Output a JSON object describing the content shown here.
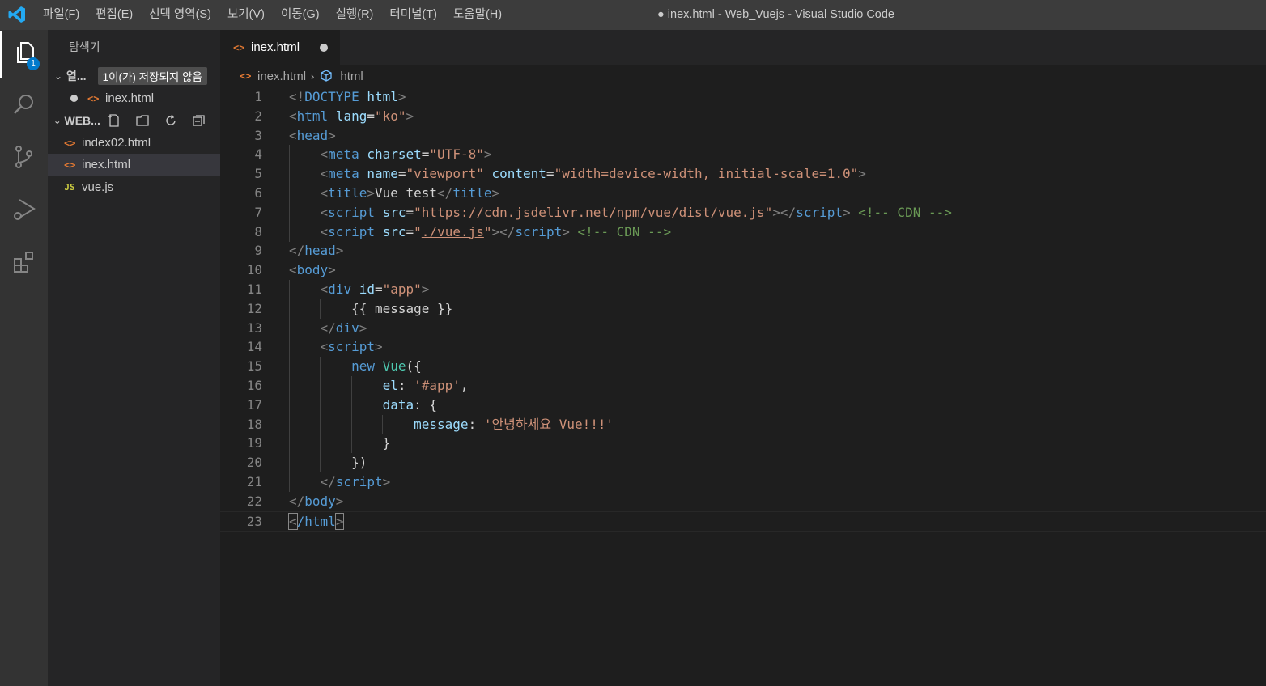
{
  "titlebar": {
    "menu": [
      "파일(F)",
      "편집(E)",
      "선택 영역(S)",
      "보기(V)",
      "이동(G)",
      "실행(R)",
      "터미널(T)",
      "도움말(H)"
    ],
    "window_title": "● inex.html - Web_Vuejs - Visual Studio Code"
  },
  "activity": {
    "explorer_badge": "1",
    "items": [
      "explorer-icon",
      "search-icon",
      "source-control-icon",
      "run-debug-icon",
      "extensions-icon"
    ]
  },
  "sidebar": {
    "title": "탐색기",
    "open_editors": {
      "label": "열...",
      "unsaved_badge": "1이(가) 저장되지 않음",
      "files": [
        "inex.html"
      ]
    },
    "workspace": {
      "label": "WEB...",
      "files": [
        {
          "name": "index02.html",
          "icon": "html-file-icon"
        },
        {
          "name": "inex.html",
          "icon": "html-file-icon"
        },
        {
          "name": "vue.js",
          "icon": "js-file-icon"
        }
      ]
    }
  },
  "tab": {
    "name": "inex.html"
  },
  "breadcrumb": {
    "file": "inex.html",
    "symbol": "html"
  },
  "editor": {
    "line_numbers": [
      "1",
      "2",
      "3",
      "4",
      "5",
      "6",
      "7",
      "8",
      "9",
      "10",
      "11",
      "12",
      "13",
      "14",
      "15",
      "16",
      "17",
      "18",
      "19",
      "20",
      "21",
      "22",
      "23"
    ],
    "lines": [
      [
        [
          "t",
          "<!"
        ],
        [
          "tn",
          "DOCTYPE"
        ],
        [
          "tx",
          " "
        ],
        [
          "an",
          "html"
        ],
        [
          "t",
          ">"
        ]
      ],
      [
        [
          "t",
          "<"
        ],
        [
          "tn",
          "html"
        ],
        [
          "tx",
          " "
        ],
        [
          "an",
          "lang"
        ],
        [
          "tx",
          "="
        ],
        [
          "av",
          "\"ko\""
        ],
        [
          "t",
          ">"
        ]
      ],
      [
        [
          "t",
          "<"
        ],
        [
          "tn",
          "head"
        ],
        [
          "t",
          ">"
        ]
      ],
      [
        [
          "tx",
          "    "
        ],
        [
          "t",
          "<"
        ],
        [
          "tn",
          "meta"
        ],
        [
          "tx",
          " "
        ],
        [
          "an",
          "charset"
        ],
        [
          "tx",
          "="
        ],
        [
          "av",
          "\"UTF-8\""
        ],
        [
          "t",
          ">"
        ]
      ],
      [
        [
          "tx",
          "    "
        ],
        [
          "t",
          "<"
        ],
        [
          "tn",
          "meta"
        ],
        [
          "tx",
          " "
        ],
        [
          "an",
          "name"
        ],
        [
          "tx",
          "="
        ],
        [
          "av",
          "\"viewport\""
        ],
        [
          "tx",
          " "
        ],
        [
          "an",
          "content"
        ],
        [
          "tx",
          "="
        ],
        [
          "av",
          "\"width=device-width, initial-scale=1.0\""
        ],
        [
          "t",
          ">"
        ]
      ],
      [
        [
          "tx",
          "    "
        ],
        [
          "t",
          "<"
        ],
        [
          "tn",
          "title"
        ],
        [
          "t",
          ">"
        ],
        [
          "tx",
          "Vue test"
        ],
        [
          "t",
          "</"
        ],
        [
          "tn",
          "title"
        ],
        [
          "t",
          ">"
        ]
      ],
      [
        [
          "tx",
          "    "
        ],
        [
          "t",
          "<"
        ],
        [
          "tn",
          "script"
        ],
        [
          "tx",
          " "
        ],
        [
          "an",
          "src"
        ],
        [
          "tx",
          "="
        ],
        [
          "av",
          "\""
        ],
        [
          "avu",
          "https://cdn.jsdelivr.net/npm/vue/dist/vue.js"
        ],
        [
          "av",
          "\""
        ],
        [
          "t",
          "></"
        ],
        [
          "tn",
          "script"
        ],
        [
          "t",
          ">"
        ],
        [
          "tx",
          " "
        ],
        [
          "cm",
          "<!-- CDN -->"
        ]
      ],
      [
        [
          "tx",
          "    "
        ],
        [
          "t",
          "<"
        ],
        [
          "tn",
          "script"
        ],
        [
          "tx",
          " "
        ],
        [
          "an",
          "src"
        ],
        [
          "tx",
          "="
        ],
        [
          "av",
          "\""
        ],
        [
          "avu",
          "./vue.js"
        ],
        [
          "av",
          "\""
        ],
        [
          "t",
          "></"
        ],
        [
          "tn",
          "script"
        ],
        [
          "t",
          ">"
        ],
        [
          "tx",
          " "
        ],
        [
          "cm",
          "<!-- CDN -->"
        ]
      ],
      [
        [
          "t",
          "</"
        ],
        [
          "tn",
          "head"
        ],
        [
          "t",
          ">"
        ]
      ],
      [
        [
          "t",
          "<"
        ],
        [
          "tn",
          "body"
        ],
        [
          "t",
          ">"
        ]
      ],
      [
        [
          "tx",
          "    "
        ],
        [
          "t",
          "<"
        ],
        [
          "tn",
          "div"
        ],
        [
          "tx",
          " "
        ],
        [
          "an",
          "id"
        ],
        [
          "tx",
          "="
        ],
        [
          "av",
          "\"app\""
        ],
        [
          "t",
          ">"
        ]
      ],
      [
        [
          "tx",
          "        {{ message }}"
        ]
      ],
      [
        [
          "tx",
          "    "
        ],
        [
          "t",
          "</"
        ],
        [
          "tn",
          "div"
        ],
        [
          "t",
          ">"
        ]
      ],
      [
        [
          "tx",
          "    "
        ],
        [
          "t",
          "<"
        ],
        [
          "tn",
          "script"
        ],
        [
          "t",
          ">"
        ]
      ],
      [
        [
          "tx",
          "        "
        ],
        [
          "tn",
          "new"
        ],
        [
          "tx",
          " "
        ],
        [
          "ty",
          "Vue"
        ],
        [
          "tx",
          "({"
        ]
      ],
      [
        [
          "tx",
          "            "
        ],
        [
          "an",
          "el"
        ],
        [
          "tx",
          ": "
        ],
        [
          "av",
          "'#app'"
        ],
        [
          "tx",
          ","
        ]
      ],
      [
        [
          "tx",
          "            "
        ],
        [
          "an",
          "data"
        ],
        [
          "tx",
          ": {"
        ]
      ],
      [
        [
          "tx",
          "                "
        ],
        [
          "an",
          "message"
        ],
        [
          "tx",
          ": "
        ],
        [
          "av",
          "'안녕하세요 Vue!!!'"
        ]
      ],
      [
        [
          "tx",
          "            }"
        ]
      ],
      [
        [
          "tx",
          "        })"
        ]
      ],
      [
        [
          "tx",
          "    "
        ],
        [
          "t",
          "</"
        ],
        [
          "tn",
          "script"
        ],
        [
          "t",
          ">"
        ]
      ],
      [
        [
          "t",
          "</"
        ],
        [
          "tn",
          "body"
        ],
        [
          "t",
          ">"
        ]
      ],
      [
        [
          "tb",
          "<"
        ],
        [
          "tn",
          "/html"
        ],
        [
          "tb",
          ">"
        ]
      ]
    ]
  },
  "colors": {
    "accent": "#007acc",
    "tag_bracket": "#808080",
    "tag_name": "#569cd6",
    "attr_name": "#9cdcfe",
    "attr_value": "#ce9178",
    "comment": "#6a9955",
    "class_name": "#4ec9b0"
  }
}
